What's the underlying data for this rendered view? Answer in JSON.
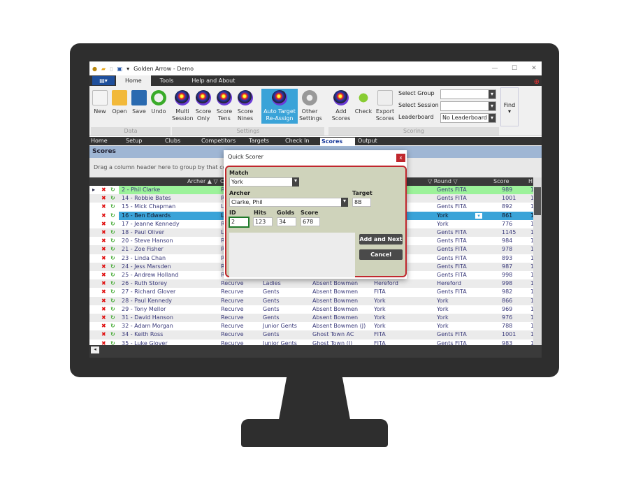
{
  "window": {
    "title": "Golden Arrow - Demo",
    "minimize": "—",
    "maximize": "☐",
    "close": "✕"
  },
  "menu_tabs": [
    "Home",
    "Tools",
    "Help and About"
  ],
  "ribbon": {
    "data_buttons": [
      "New",
      "Open",
      "Save",
      "Undo"
    ],
    "data_group": "Data",
    "settings_buttons": [
      [
        "Multi",
        "Session"
      ],
      [
        "Score",
        "Only"
      ],
      [
        "Score",
        "Tens"
      ],
      [
        "Score",
        "Nines"
      ],
      [
        "Auto Target",
        "Re-Assign"
      ],
      [
        "Other",
        "Settings"
      ]
    ],
    "settings_group": "Settings",
    "scoring_buttons": [
      [
        "Add",
        "Scores"
      ],
      [
        "Check",
        ""
      ],
      [
        "Export",
        "Scores"
      ]
    ],
    "select_group_label": "Select Group",
    "select_group_value": "",
    "select_session_label": "Select Session",
    "select_session_value": "",
    "leaderboard_label": "Leaderboard",
    "leaderboard_value": "No Leaderboard",
    "scoring_group": "Scoring",
    "find": "Find"
  },
  "nav": [
    "Home",
    "Setup",
    "Clubs",
    "Competitors",
    "Targets",
    "Check In",
    "Scores",
    "Output"
  ],
  "nav_active": "Scores",
  "panel_title": "Scores",
  "group_hint": "Drag a column header here to group by that column",
  "columns": {
    "archer": "Archer ▲ ▽",
    "bow": "C",
    "round": "▽ Round ▽",
    "score": "Score",
    "h": "H"
  },
  "rows": [
    {
      "archer": "2 - Phil Clarke",
      "bow": "R",
      "cls": "",
      "club": "",
      "tround": "",
      "round": "Gents FITA",
      "score": "989",
      "h": "1",
      "state": "current"
    },
    {
      "archer": "14 - Robbie Bates",
      "bow": "R",
      "cls": "",
      "club": "",
      "tround": "",
      "round": "Gents FITA",
      "score": "1001",
      "h": "1"
    },
    {
      "archer": "15 - Mick Chapman",
      "bow": "L",
      "cls": "",
      "club": "",
      "tround": "",
      "round": "Gents FITA",
      "score": "892",
      "h": "1"
    },
    {
      "archer": "16 - Ben Edwards",
      "bow": "L",
      "cls": "",
      "club": "",
      "tround": "",
      "round": "York",
      "score": "861",
      "h": "1",
      "state": "selected"
    },
    {
      "archer": "17 - Jeanne Kennedy",
      "bow": "R",
      "cls": "",
      "club": "",
      "tround": "",
      "round": "York",
      "score": "776",
      "h": "1"
    },
    {
      "archer": "18 - Paul Oliver",
      "bow": "L",
      "cls": "",
      "club": "",
      "tround": "",
      "round": "Gents FITA",
      "score": "1145",
      "h": "1"
    },
    {
      "archer": "20 - Steve Hanson",
      "bow": "R",
      "cls": "",
      "club": "",
      "tround": "",
      "round": "Gents FITA",
      "score": "984",
      "h": "1"
    },
    {
      "archer": "21 - Zoe Fisher",
      "bow": "R",
      "cls": "",
      "club": "",
      "tround": "",
      "round": "Gents FITA",
      "score": "978",
      "h": "1"
    },
    {
      "archer": "23 - Linda Chan",
      "bow": "R",
      "cls": "",
      "club": "",
      "tround": "",
      "round": "Gents FITA",
      "score": "893",
      "h": "1"
    },
    {
      "archer": "24 - Jess Marsden",
      "bow": "R",
      "cls": "",
      "club": "",
      "tround": "",
      "round": "Gents FITA",
      "score": "987",
      "h": "1"
    },
    {
      "archer": "25 - Andrew Holland",
      "bow": "R",
      "cls": "",
      "club": "",
      "tround": "",
      "round": "Gents FITA",
      "score": "998",
      "h": "1"
    },
    {
      "archer": "26 - Ruth Storey",
      "bow": "Recurve",
      "cls": "Ladies",
      "club": "Absent Bowmen",
      "tround": "Hereford",
      "round": "Hereford",
      "score": "998",
      "h": "1"
    },
    {
      "archer": "27 - Richard Glover",
      "bow": "Recurve",
      "cls": "Gents",
      "club": "Absent Bowmen",
      "tround": "FITA",
      "round": "Gents FITA",
      "score": "982",
      "h": "1"
    },
    {
      "archer": "28 - Paul Kennedy",
      "bow": "Recurve",
      "cls": "Gents",
      "club": "Absent Bowmen",
      "tround": "York",
      "round": "York",
      "score": "866",
      "h": "1"
    },
    {
      "archer": "29 - Tony Mellor",
      "bow": "Recurve",
      "cls": "Gents",
      "club": "Absent Bowmen",
      "tround": "York",
      "round": "York",
      "score": "969",
      "h": "1"
    },
    {
      "archer": "31 - David Hanson",
      "bow": "Recurve",
      "cls": "Gents",
      "club": "Absent Bowmen",
      "tround": "York",
      "round": "York",
      "score": "976",
      "h": "1"
    },
    {
      "archer": "32 - Adam Morgan",
      "bow": "Recurve",
      "cls": "Junior Gents",
      "club": "Absent Bowmen (J)",
      "tround": "York",
      "round": "York",
      "score": "788",
      "h": "1"
    },
    {
      "archer": "34 - Keith Ross",
      "bow": "Recurve",
      "cls": "Gents",
      "club": "Ghost Town AC",
      "tround": "FITA",
      "round": "Gents FITA",
      "score": "1001",
      "h": "1"
    },
    {
      "archer": "35 - Luke Glover",
      "bow": "Recurve",
      "cls": "Junior Gents",
      "club": "Ghost Town (J)",
      "tround": "FITA",
      "round": "Gents FITA",
      "score": "983",
      "h": "1"
    }
  ],
  "dialog": {
    "title": "Quick Scorer",
    "close": "x",
    "match_label": "Match",
    "match_value": "York",
    "archer_label": "Archer",
    "archer_value": "Clarke, Phil",
    "target_label": "Target",
    "target_value": "8B",
    "id_label": "ID",
    "id_value": "2",
    "hits_label": "Hits",
    "hits_value": "123",
    "golds_label": "Golds",
    "golds_value": "34",
    "score_label": "Score",
    "score_value": "678",
    "add_next": "Add and Next",
    "cancel": "Cancel"
  },
  "colors": {
    "selected_row": "#3aa3d8",
    "current_row": "#9cf29a",
    "dialog_border": "#c0272d",
    "dialog_bg": "#cfd3bb",
    "bezel": "#2e2e2e"
  }
}
